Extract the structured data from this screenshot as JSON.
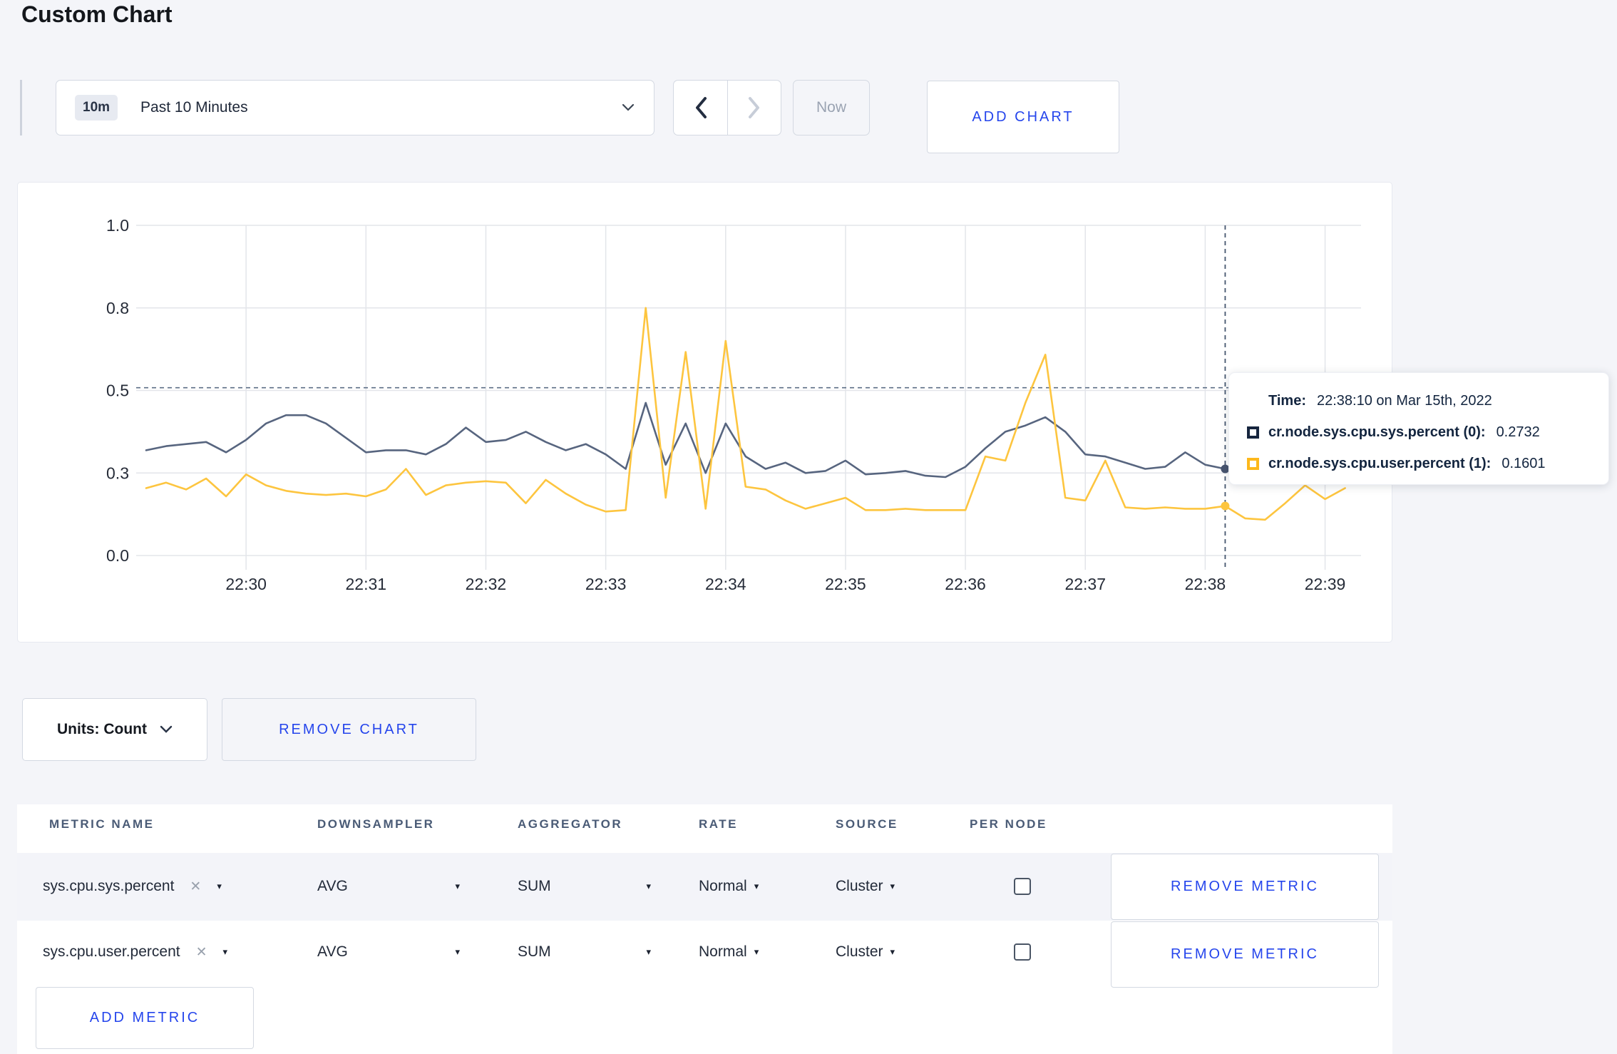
{
  "title": "Custom Chart",
  "toolbar": {
    "range_badge": "10m",
    "range_label": "Past 10 Minutes",
    "now_label": "Now",
    "add_chart_label": "ADD CHART"
  },
  "chart_data": {
    "type": "line",
    "title": "",
    "xlabel": "",
    "ylabel": "",
    "ylim": [
      0.0,
      1.0
    ],
    "grid": true,
    "legend_position": "none",
    "y_ticks": [
      0.0,
      0.3,
      0.5,
      0.8,
      1.0
    ],
    "y_tick_labels": [
      "0.0",
      "0.3",
      "0.5",
      "0.8",
      "1.0"
    ],
    "x_tick_labels": [
      "22:30",
      "22:31",
      "22:32",
      "22:33",
      "22:34",
      "22:35",
      "22:36",
      "22:37",
      "22:38",
      "22:39"
    ],
    "x_start_time": "22:29:10",
    "x_step_seconds": 10,
    "series": [
      {
        "name": "cr.node.sys.cpu.sys.percent",
        "color": "#57657f",
        "values": [
          0.355,
          0.365,
          0.37,
          0.375,
          0.35,
          0.38,
          0.42,
          0.44,
          0.44,
          0.42,
          0.385,
          0.35,
          0.355,
          0.355,
          0.345,
          0.37,
          0.41,
          0.375,
          0.38,
          0.4,
          0.375,
          0.355,
          0.37,
          0.345,
          0.31,
          0.47,
          0.32,
          0.42,
          0.3,
          0.42,
          0.34,
          0.31,
          0.325,
          0.3,
          0.305,
          0.33,
          0.295,
          0.3,
          0.305,
          0.29,
          0.285,
          0.315,
          0.36,
          0.4,
          0.415,
          0.435,
          0.4,
          0.345,
          0.34,
          0.325,
          0.31,
          0.315,
          0.35,
          0.32,
          0.31,
          0.315,
          0.3,
          0.3,
          0.31,
          0.3,
          0.305
        ]
      },
      {
        "name": "cr.node.sys.cpu.user.percent",
        "color": "#fdc53f",
        "values": [
          0.245,
          0.265,
          0.24,
          0.28,
          0.215,
          0.295,
          0.255,
          0.235,
          0.225,
          0.22,
          0.225,
          0.215,
          0.24,
          0.31,
          0.22,
          0.255,
          0.265,
          0.27,
          0.265,
          0.19,
          0.275,
          0.225,
          0.185,
          0.16,
          0.165,
          0.8,
          0.21,
          0.64,
          0.17,
          0.68,
          0.25,
          0.24,
          0.2,
          0.17,
          0.19,
          0.21,
          0.165,
          0.165,
          0.17,
          0.165,
          0.165,
          0.165,
          0.34,
          0.33,
          0.47,
          0.63,
          0.21,
          0.2,
          0.33,
          0.175,
          0.17,
          0.175,
          0.17,
          0.17,
          0.18,
          0.135,
          0.13,
          0.19,
          0.255,
          0.205,
          0.245
        ]
      }
    ],
    "crosshair": {
      "x_index": 54,
      "hline_value": 0.51,
      "time": "22:38:10"
    }
  },
  "tooltip": {
    "time_label": "Time:",
    "time_value": "22:38:10 on Mar 15th, 2022",
    "series": [
      {
        "label": "cr.node.sys.cpu.sys.percent (0):",
        "value": "0.2732",
        "color": "#16253e"
      },
      {
        "label": "cr.node.sys.cpu.user.percent (1):",
        "value": "0.1601",
        "color": "#fdb81c"
      }
    ]
  },
  "chart_footer": {
    "units_label": "Units: Count",
    "remove_chart_label": "REMOVE CHART"
  },
  "metrics_table": {
    "columns": [
      "METRIC NAME",
      "DOWNSAMPLER",
      "AGGREGATOR",
      "RATE",
      "SOURCE",
      "PER NODE"
    ],
    "rows": [
      {
        "metric": "sys.cpu.sys.percent",
        "remove_x": "✕",
        "downsampler": "AVG",
        "aggregator": "SUM",
        "rate": "Normal",
        "source": "Cluster",
        "per_node": false,
        "remove_label": "REMOVE METRIC"
      },
      {
        "metric": "sys.cpu.user.percent",
        "remove_x": "✕",
        "downsampler": "AVG",
        "aggregator": "SUM",
        "rate": "Normal",
        "source": "Cluster",
        "per_node": false,
        "remove_label": "REMOVE METRIC"
      }
    ],
    "add_metric_label": "ADD METRIC",
    "caret": "▾"
  }
}
